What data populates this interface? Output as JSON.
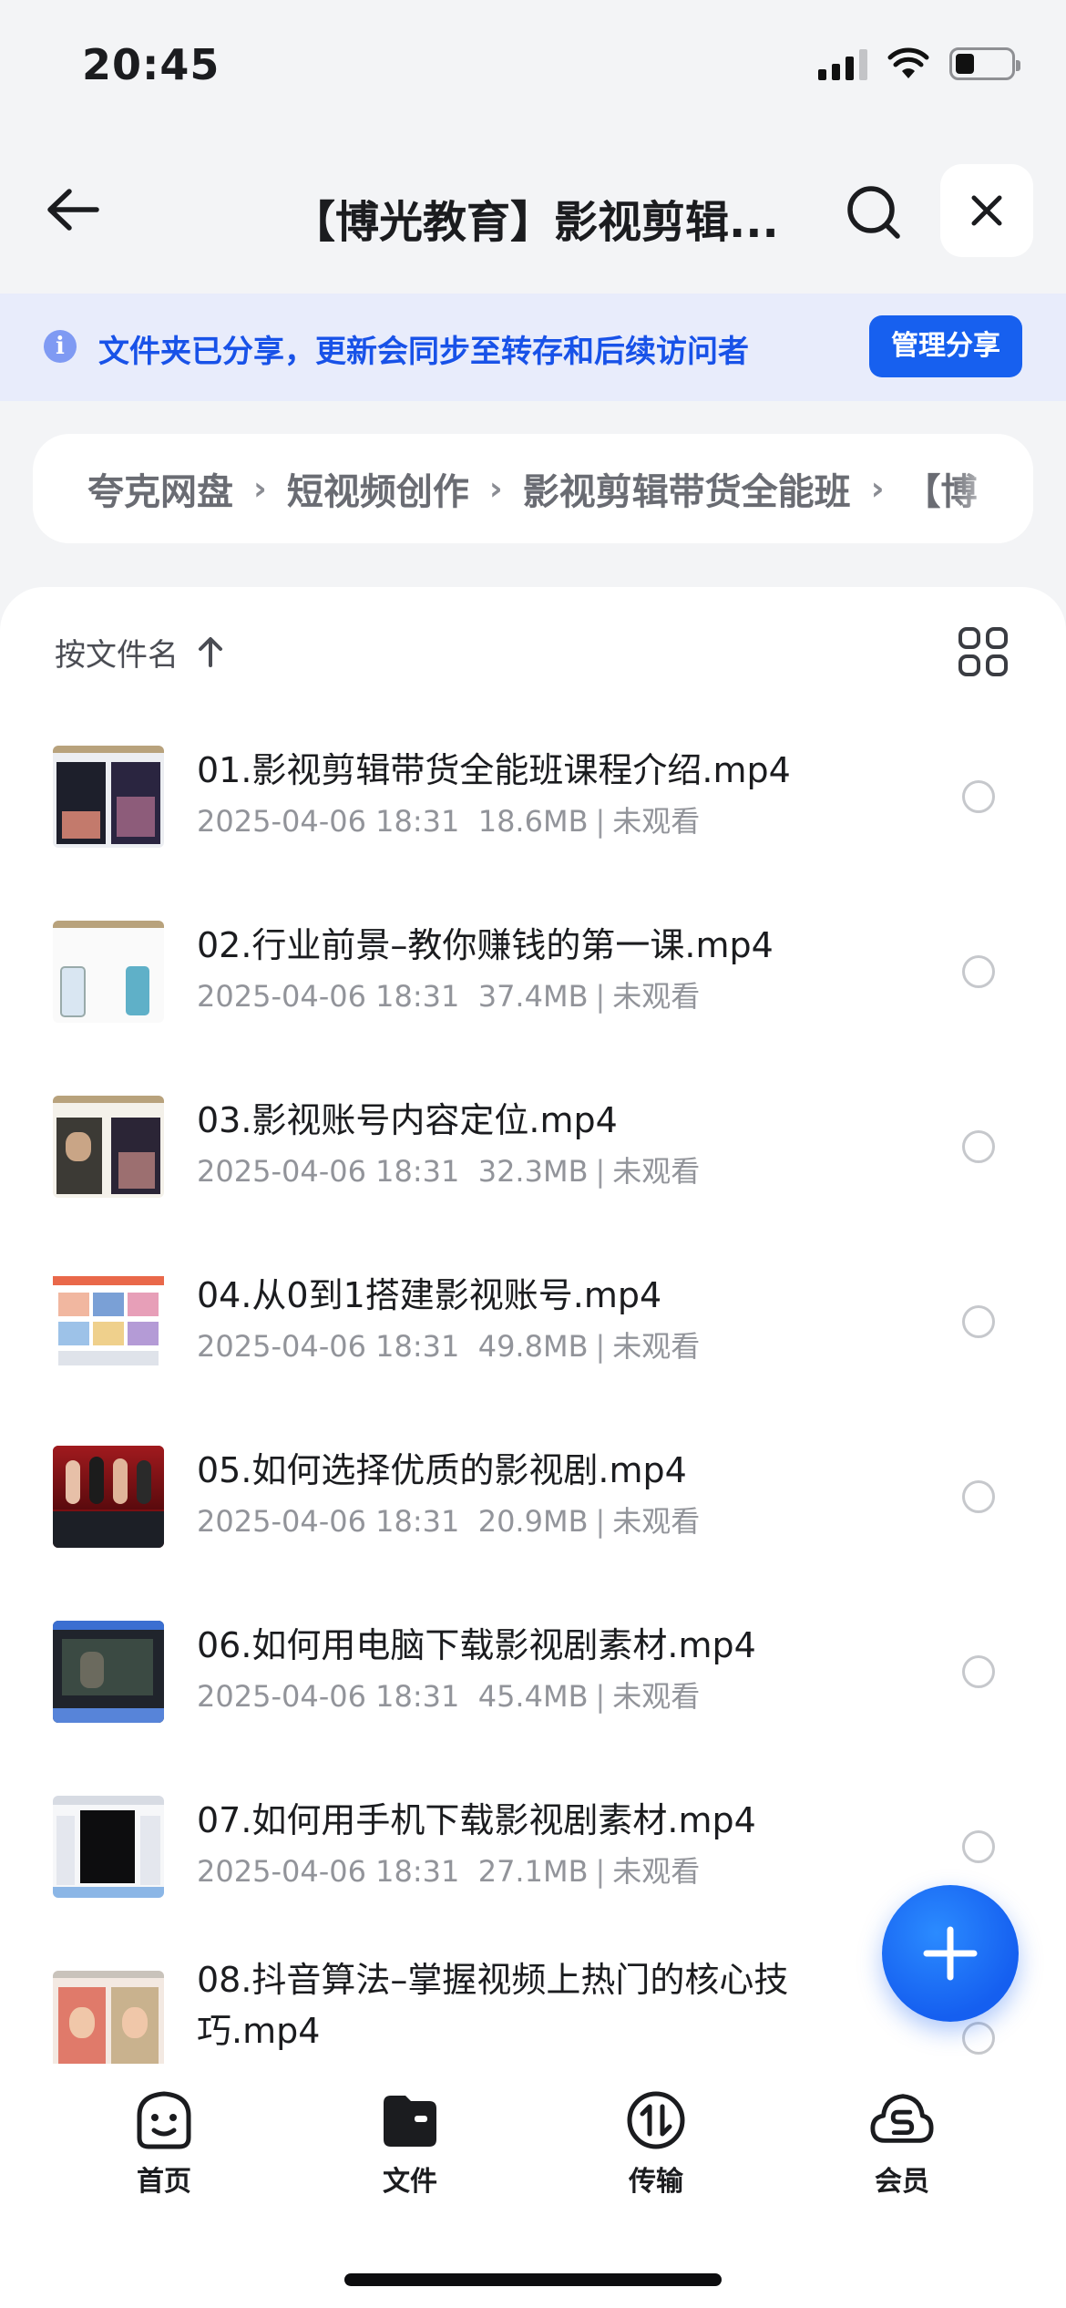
{
  "status_bar": {
    "time": "20:45"
  },
  "header": {
    "title": "【博光教育】影视剪辑..."
  },
  "share_banner": {
    "text": "文件夹已分享，更新会同步至转存和后续访问者",
    "manage_label": "管理分享"
  },
  "breadcrumb": [
    "夸克网盘",
    "短视频创作",
    "影视剪辑带货全能班",
    "【博"
  ],
  "sort": {
    "label": "按文件名"
  },
  "files": [
    {
      "name": "01.影视剪辑带货全能班课程介绍.mp4",
      "date": "2025-04-06 18:31",
      "size": "18.6MB",
      "status": "未观看"
    },
    {
      "name": "02.行业前景–教你赚钱的第一课.mp4",
      "date": "2025-04-06 18:31",
      "size": "37.4MB",
      "status": "未观看"
    },
    {
      "name": "03.影视账号内容定位.mp4",
      "date": "2025-04-06 18:31",
      "size": "32.3MB",
      "status": "未观看"
    },
    {
      "name": "04.从0到1搭建影视账号.mp4",
      "date": "2025-04-06 18:31",
      "size": "49.8MB",
      "status": "未观看"
    },
    {
      "name": "05.如何选择优质的影视剧.mp4",
      "date": "2025-04-06 18:31",
      "size": "20.9MB",
      "status": "未观看"
    },
    {
      "name": "06.如何用电脑下载影视剧素材.mp4",
      "date": "2025-04-06 18:31",
      "size": "45.4MB",
      "status": "未观看"
    },
    {
      "name": "07.如何用手机下载影视剧素材.mp4",
      "date": "2025-04-06 18:31",
      "size": "27.1MB",
      "status": "未观看"
    },
    {
      "name": "08.抖音算法–掌握视频上热门的核心技巧.mp4",
      "date": "",
      "size": "",
      "status": ""
    }
  ],
  "tabs": [
    {
      "label": "首页",
      "icon": "home-face-icon"
    },
    {
      "label": "文件",
      "icon": "folder-icon"
    },
    {
      "label": "传输",
      "icon": "transfer-icon"
    },
    {
      "label": "会员",
      "icon": "member-cloud-icon"
    }
  ],
  "colors": {
    "accent": "#1760ef",
    "banner_bg": "#e8ecfb",
    "banner_text": "#1852e8"
  }
}
